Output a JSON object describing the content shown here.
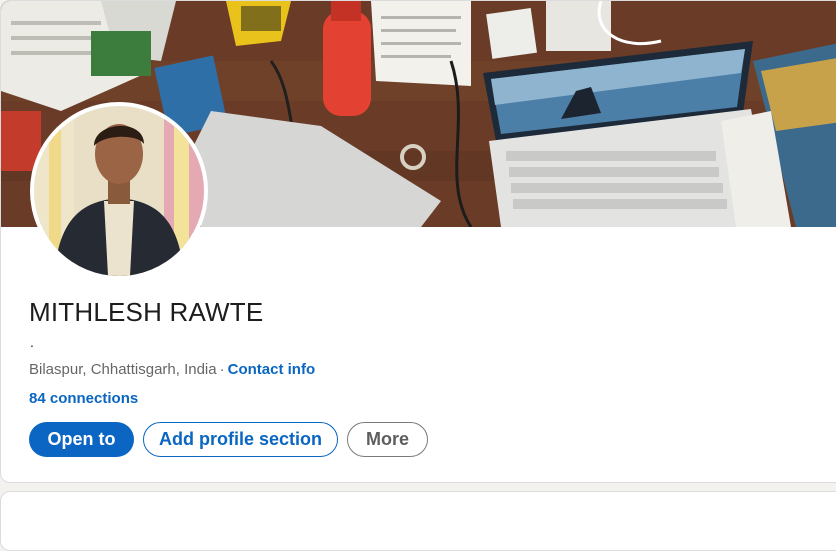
{
  "profile": {
    "name": "MITHLESH RAWTE",
    "headline": ".",
    "location": "Bilaspur, Chhattisgarh, India",
    "separator": "·",
    "contact_info_label": "Contact info",
    "connections_label": "84 connections"
  },
  "actions": {
    "open_to_label": "Open to",
    "add_section_label": "Add profile section",
    "more_label": "More"
  },
  "colors": {
    "brand": "#0a66c2",
    "page_background": "#f4f2ee",
    "card_background": "#ffffff"
  }
}
